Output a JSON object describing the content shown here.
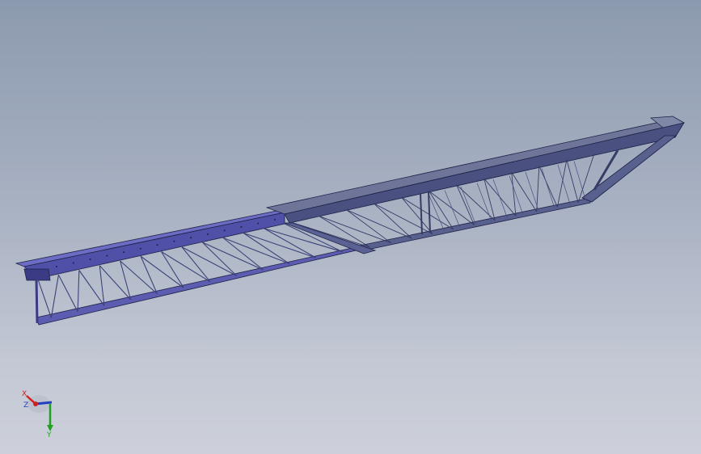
{
  "viewport": {
    "background_top": "#8c9aaf",
    "background_bottom": "#cdd0da"
  },
  "model": {
    "name": "",
    "colors": {
      "section_a": "#5c5cb0",
      "section_a_dark": "#3a3a85",
      "section_b": "#58608e",
      "section_b_dark": "#363c66",
      "lattice": "#3c4278",
      "outline": "#1e2046"
    }
  },
  "triad": {
    "x_label": "X",
    "z_label": "Z",
    "y_label": "Y",
    "colors": {
      "x": "#d02020",
      "y": "#20a020",
      "z": "#2040c0"
    }
  }
}
